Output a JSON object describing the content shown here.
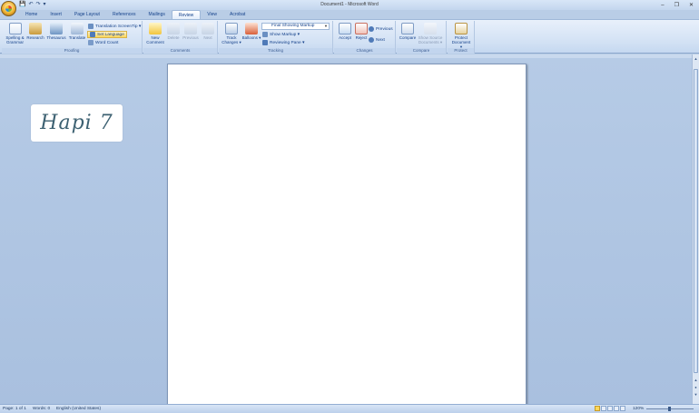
{
  "window": {
    "title": "Document1 - Microsoft Word",
    "controls": {
      "minimize": "–",
      "restore": "❐",
      "close": "✕"
    }
  },
  "quick_access": {
    "save": "💾",
    "undo": "↶",
    "redo": "↷",
    "customize": "▾"
  },
  "tabs": [
    {
      "label": "Home",
      "active": false
    },
    {
      "label": "Insert",
      "active": false
    },
    {
      "label": "Page Layout",
      "active": false
    },
    {
      "label": "References",
      "active": false
    },
    {
      "label": "Mailings",
      "active": false
    },
    {
      "label": "Review",
      "active": true
    },
    {
      "label": "View",
      "active": false
    },
    {
      "label": "Acrobat",
      "active": false
    }
  ],
  "ribbon": {
    "proofing": {
      "label": "Proofing",
      "spelling": "Spelling & Grammar",
      "research": "Research",
      "thesaurus": "Thesaurus",
      "translate": "Translate",
      "translation_screentip": "Translation ScreenTip ▾",
      "set_language": "Set Language",
      "word_count": "Word Count"
    },
    "comments": {
      "label": "Comments",
      "new": "New Comment",
      "delete": "Delete",
      "previous": "Previous",
      "next": "Next"
    },
    "tracking": {
      "label": "Tracking",
      "track_changes": "Track Changes ▾",
      "balloons": "Balloons ▾",
      "display_mode": "Final Showing Markup",
      "show_markup": "Show Markup ▾",
      "reviewing_pane": "Reviewing Pane ▾"
    },
    "changes": {
      "label": "Changes",
      "accept": "Accept",
      "reject": "Reject",
      "previous": "Previous",
      "next": "Next"
    },
    "compare": {
      "label": "Compare",
      "compare": "Compare",
      "show_source": "Show Source Documents ▾"
    },
    "protect": {
      "label": "Protect",
      "protect_document": "Protect Document ▾"
    }
  },
  "document": {
    "sticker_text": "Hapi 7"
  },
  "status": {
    "page": "Page: 1 of 1",
    "words": "Words: 0",
    "language": "English (United States)",
    "zoom": "120%"
  }
}
